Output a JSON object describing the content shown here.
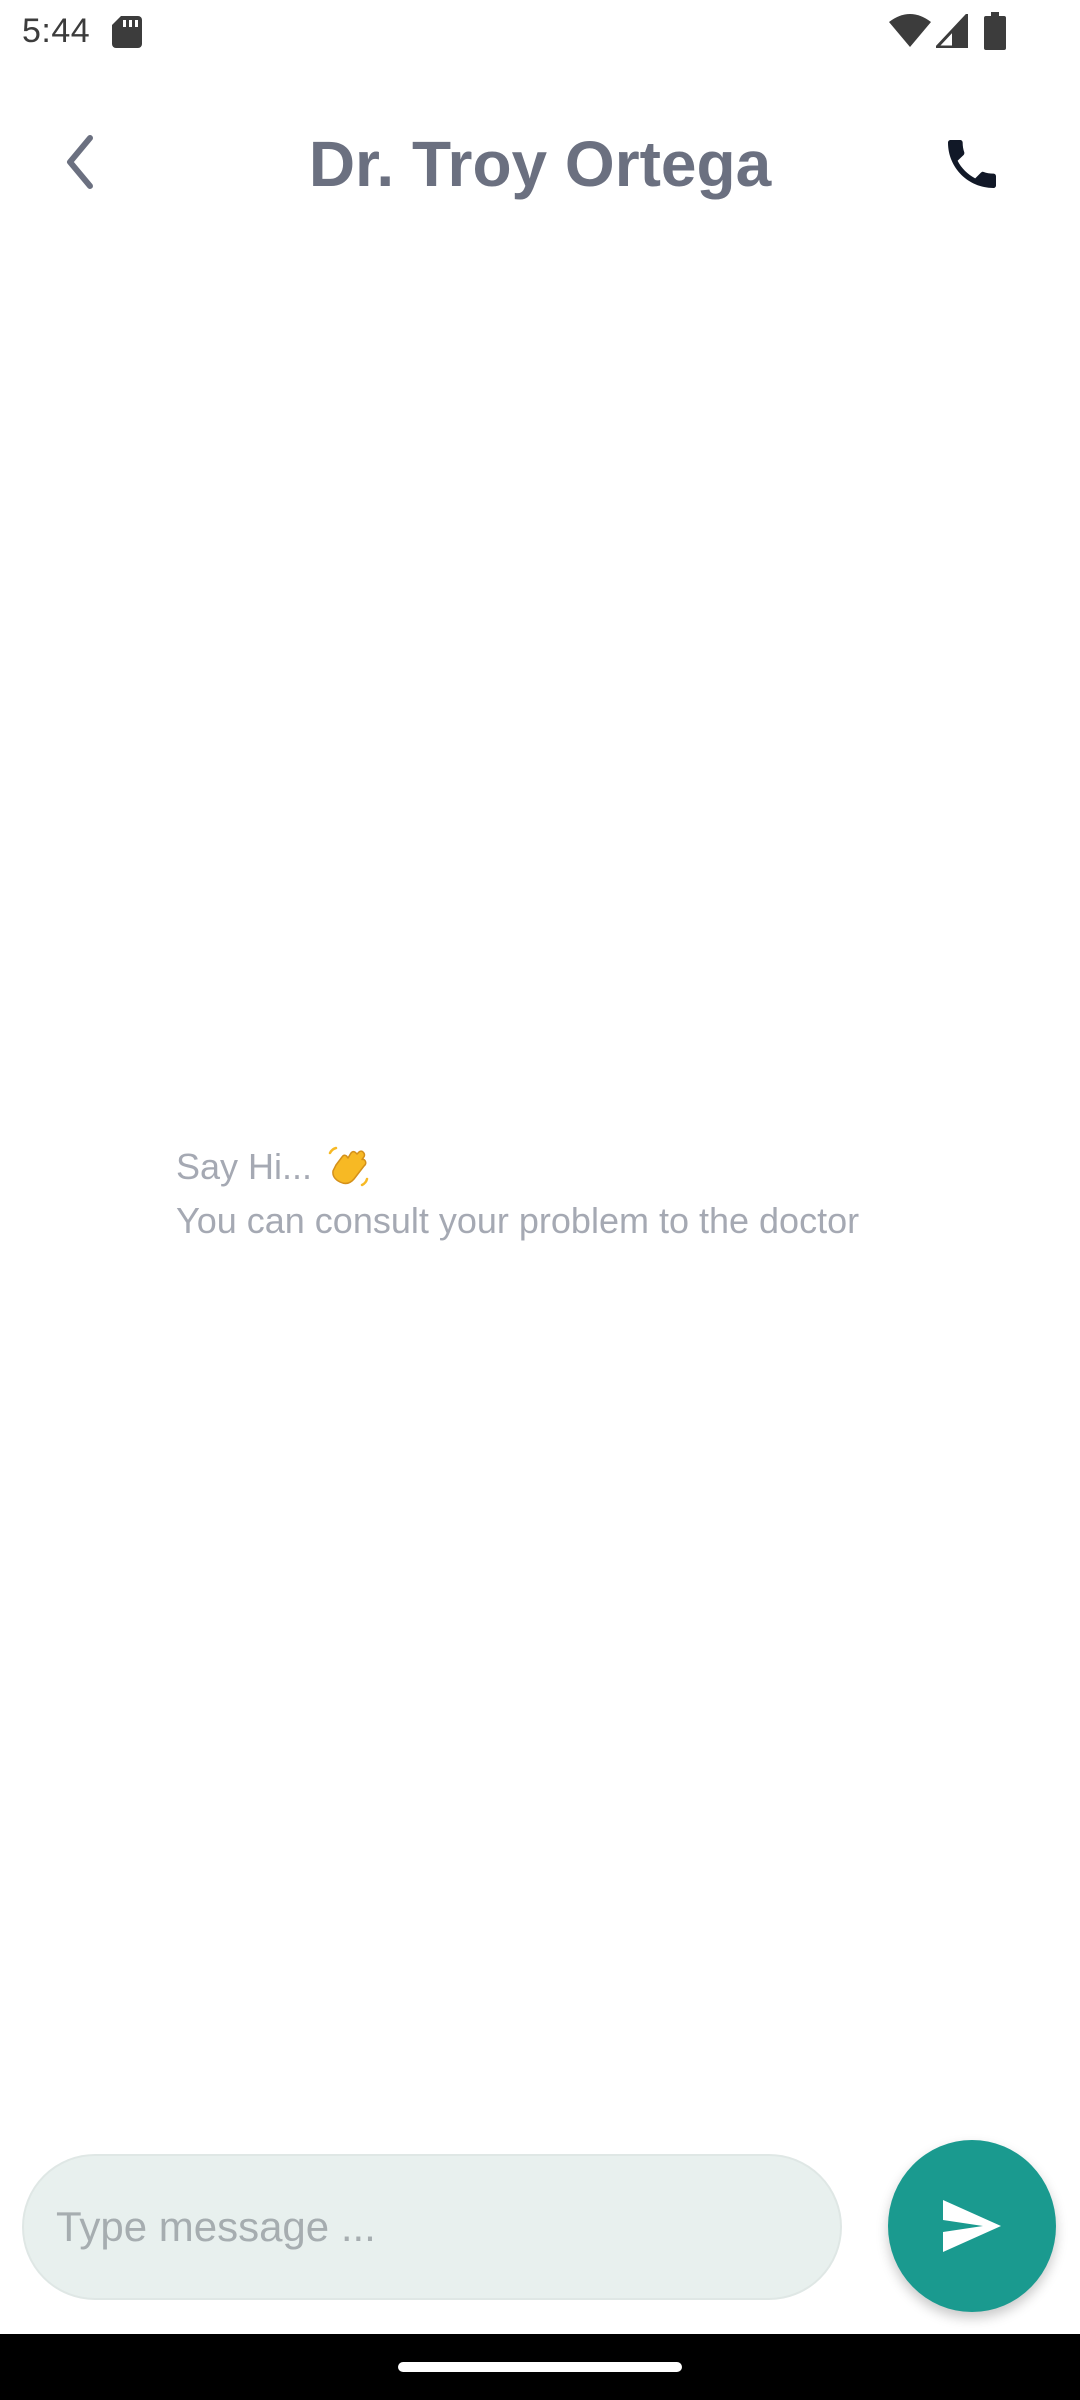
{
  "status_bar": {
    "time": "5:44",
    "icons": [
      "sd-card-icon",
      "wifi-icon",
      "signal-icon",
      "battery-icon"
    ]
  },
  "header": {
    "title": "Dr. Troy Ortega",
    "back_icon": "chevron-left-icon",
    "call_icon": "phone-icon"
  },
  "empty_state": {
    "greeting": "Say Hi...",
    "greeting_icon": "waving-hand-icon",
    "subtitle": "You can consult your problem to the doctor"
  },
  "composer": {
    "placeholder": "Type message ...",
    "value": "",
    "send_icon": "send-icon"
  },
  "colors": {
    "accent": "#1a9a8f",
    "title": "#6b7080",
    "hint_text": "#a5a9b3",
    "input_background": "#e8f0ee"
  }
}
